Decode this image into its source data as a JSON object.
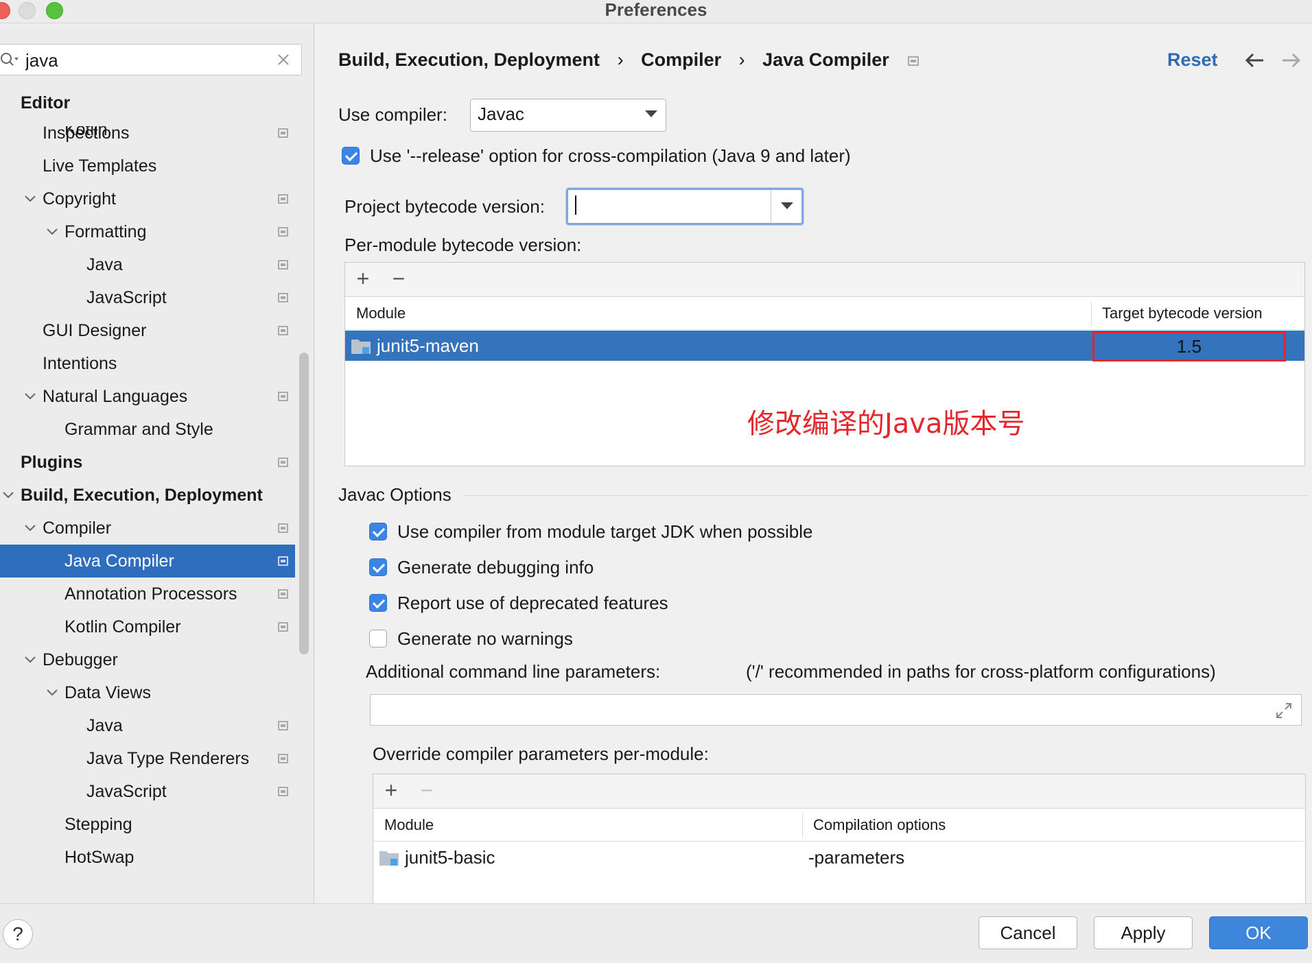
{
  "window": {
    "title": "Preferences"
  },
  "search": {
    "value": "java"
  },
  "sidebar": {
    "partial_top": "Kotlin",
    "items": [
      {
        "label": "Editor",
        "level": 0,
        "bold": true
      },
      {
        "label": "Inspections",
        "level": 1
      },
      {
        "label": "Live Templates",
        "level": 1
      },
      {
        "label": "Copyright",
        "level": 1,
        "expanded": true
      },
      {
        "label": "Formatting",
        "level": 2,
        "expanded": true
      },
      {
        "label": "Java",
        "level": 3
      },
      {
        "label": "JavaScript",
        "level": 3
      },
      {
        "label": "GUI Designer",
        "level": 1
      },
      {
        "label": "Intentions",
        "level": 1
      },
      {
        "label": "Natural Languages",
        "level": 1,
        "expanded": true
      },
      {
        "label": "Grammar and Style",
        "level": 2
      },
      {
        "label": "Plugins",
        "level": 0,
        "bold": true
      },
      {
        "label": "Build, Execution, Deployment",
        "level": 0,
        "bold": true,
        "expanded": true
      },
      {
        "label": "Compiler",
        "level": 1,
        "expanded": true
      },
      {
        "label": "Java Compiler",
        "level": 2,
        "selected": true
      },
      {
        "label": "Annotation Processors",
        "level": 2
      },
      {
        "label": "Kotlin Compiler",
        "level": 2
      },
      {
        "label": "Debugger",
        "level": 1,
        "expanded": true
      },
      {
        "label": "Data Views",
        "level": 2,
        "expanded": true
      },
      {
        "label": "Java",
        "level": 3
      },
      {
        "label": "Java Type Renderers",
        "level": 3
      },
      {
        "label": "JavaScript",
        "level": 3
      },
      {
        "label": "Stepping",
        "level": 2
      },
      {
        "label": "HotSwap",
        "level": 2
      }
    ]
  },
  "breadcrumb": {
    "part1": "Build, Execution, Deployment",
    "part2": "Compiler",
    "part3": "Java Compiler",
    "sep": "›"
  },
  "header": {
    "reset": "Reset"
  },
  "compiler": {
    "use_compiler_label": "Use compiler:",
    "use_compiler_value": "Javac",
    "release_option": "Use '--release' option for cross-compilation (Java 9 and later)",
    "project_bytecode_label": "Project bytecode version:",
    "per_module_label": "Per-module bytecode version:",
    "table": {
      "columns": [
        "Module",
        "Target bytecode version"
      ],
      "rows": [
        {
          "module": "junit5-maven",
          "version": "1.5"
        }
      ]
    },
    "annotation": "修改编译的Java版本号"
  },
  "javac": {
    "section_title": "Javac Options",
    "options": [
      {
        "label": "Use compiler from module target JDK when possible",
        "checked": true
      },
      {
        "label": "Generate debugging info",
        "checked": true
      },
      {
        "label": "Report use of deprecated features",
        "checked": true
      },
      {
        "label": "Generate no warnings",
        "checked": false
      }
    ],
    "additional_label": "Additional command line parameters:",
    "additional_hint": "('/' recommended in paths for cross-platform configurations)",
    "override_label": "Override compiler parameters per-module:",
    "override_table": {
      "columns": [
        "Module",
        "Compilation options"
      ],
      "rows": [
        {
          "module": "junit5-basic",
          "options": "-parameters"
        }
      ]
    }
  },
  "footer": {
    "help": "?",
    "cancel": "Cancel",
    "apply": "Apply",
    "ok": "OK"
  },
  "colors": {
    "accent": "#2f6ebd",
    "annotation": "#e4262d",
    "link": "#2d6db7"
  }
}
